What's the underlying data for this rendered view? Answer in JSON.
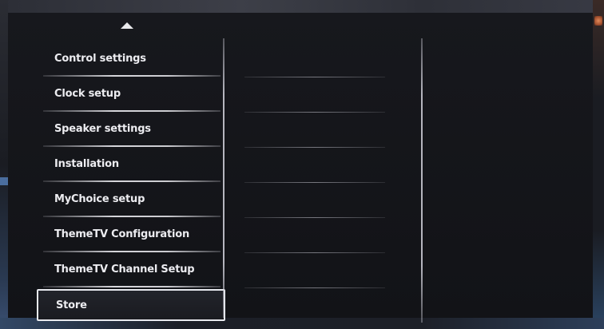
{
  "menu": {
    "items": [
      {
        "label": "Control settings",
        "selected": false
      },
      {
        "label": "Clock setup",
        "selected": false
      },
      {
        "label": "Speaker settings",
        "selected": false
      },
      {
        "label": "Installation",
        "selected": false
      },
      {
        "label": "MyChoice setup",
        "selected": false
      },
      {
        "label": "ThemeTV Configuration",
        "selected": false
      },
      {
        "label": "ThemeTV Channel Setup",
        "selected": false
      },
      {
        "label": "Store",
        "selected": true
      }
    ]
  },
  "icons": {
    "scroll_up": "chevron-up-icon"
  },
  "colors": {
    "background": "#131419",
    "text": "#ececf0",
    "highlight_border": "#e8eaef"
  }
}
